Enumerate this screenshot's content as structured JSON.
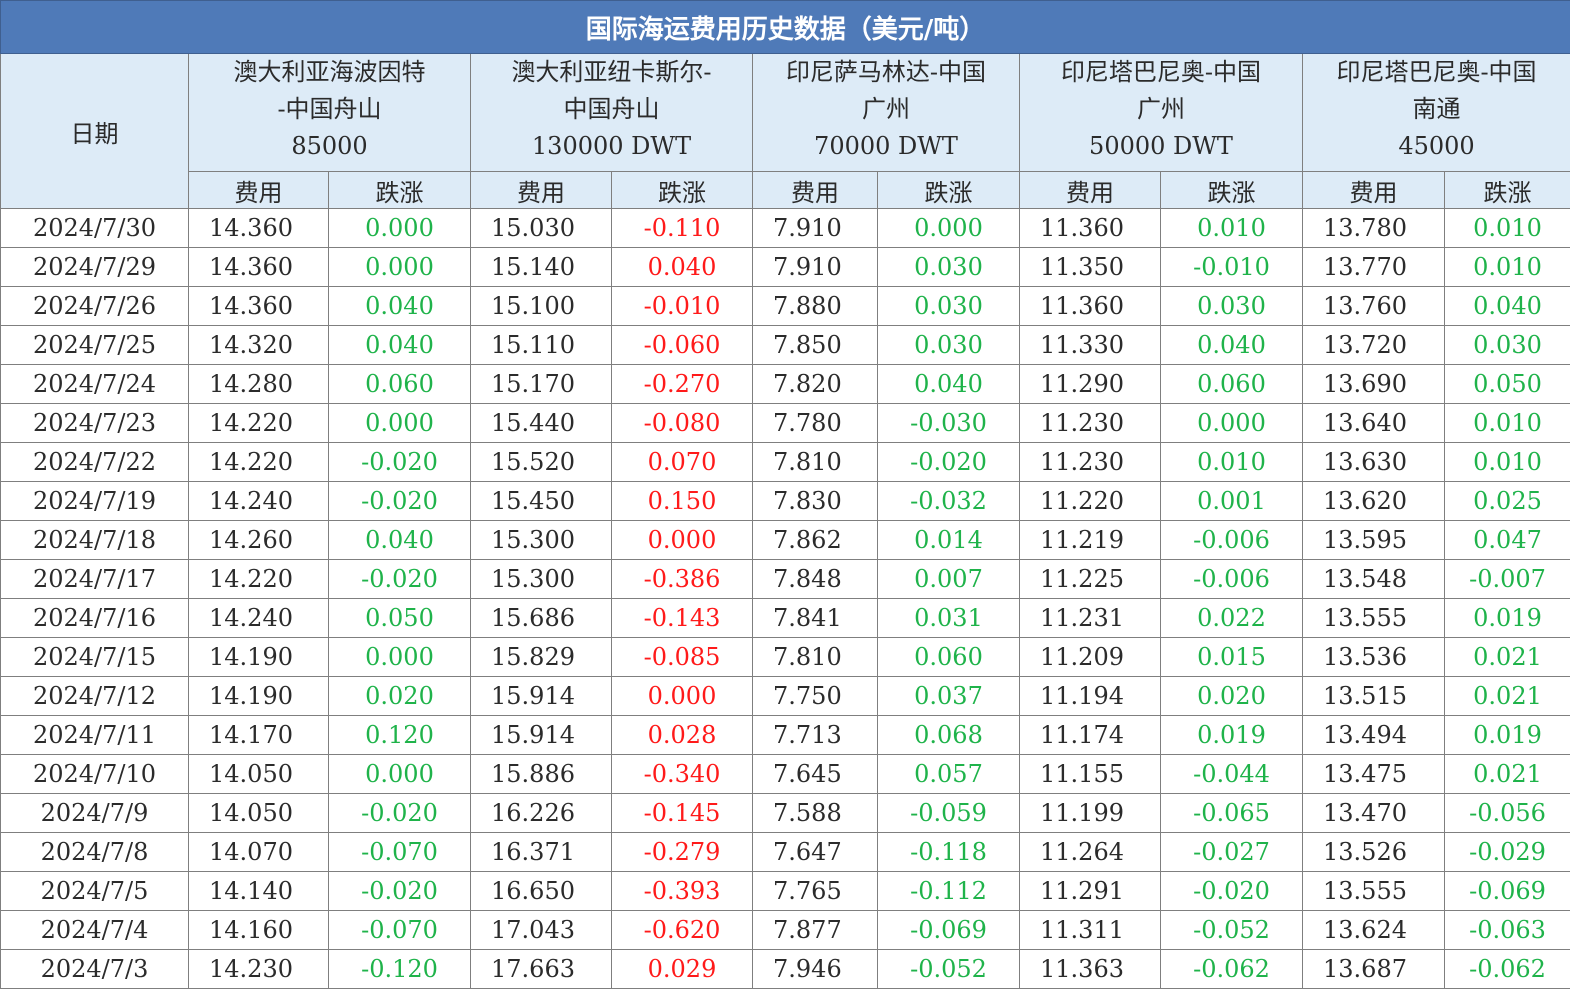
{
  "title": "国际海运费用历史数据（美元/吨）",
  "date_header": "日期",
  "sub_fee": "费用",
  "sub_change": "跌涨",
  "routes": [
    {
      "l1": "澳大利亚海波因特",
      "l2": "-中国舟山",
      "l3": "85000"
    },
    {
      "l1": "澳大利亚纽卡斯尔-",
      "l2": "中国舟山",
      "l3": "130000 DWT"
    },
    {
      "l1": "印尼萨马林达-中国",
      "l2": "广州",
      "l3": "70000 DWT"
    },
    {
      "l1": "印尼塔巴尼奥-中国",
      "l2": "广州",
      "l3": "50000 DWT"
    },
    {
      "l1": "印尼塔巴尼奥-中国",
      "l2": "南通",
      "l3": "45000"
    }
  ],
  "colors": {
    "header_bg": "#4f7ab8",
    "subheader_bg": "#ddebf7",
    "change_positive_col2": "#ff1a1a",
    "change_green": "#1fb34a"
  },
  "rows": [
    [
      "2024/7/30",
      "14.360",
      "0.000",
      "15.030",
      "-0.110",
      "7.910",
      "0.000",
      "11.360",
      "0.010",
      "13.780",
      "0.010"
    ],
    [
      "2024/7/29",
      "14.360",
      "0.000",
      "15.140",
      "0.040",
      "7.910",
      "0.030",
      "11.350",
      "-0.010",
      "13.770",
      "0.010"
    ],
    [
      "2024/7/26",
      "14.360",
      "0.040",
      "15.100",
      "-0.010",
      "7.880",
      "0.030",
      "11.360",
      "0.030",
      "13.760",
      "0.040"
    ],
    [
      "2024/7/25",
      "14.320",
      "0.040",
      "15.110",
      "-0.060",
      "7.850",
      "0.030",
      "11.330",
      "0.040",
      "13.720",
      "0.030"
    ],
    [
      "2024/7/24",
      "14.280",
      "0.060",
      "15.170",
      "-0.270",
      "7.820",
      "0.040",
      "11.290",
      "0.060",
      "13.690",
      "0.050"
    ],
    [
      "2024/7/23",
      "14.220",
      "0.000",
      "15.440",
      "-0.080",
      "7.780",
      "-0.030",
      "11.230",
      "0.000",
      "13.640",
      "0.010"
    ],
    [
      "2024/7/22",
      "14.220",
      "-0.020",
      "15.520",
      "0.070",
      "7.810",
      "-0.020",
      "11.230",
      "0.010",
      "13.630",
      "0.010"
    ],
    [
      "2024/7/19",
      "14.240",
      "-0.020",
      "15.450",
      "0.150",
      "7.830",
      "-0.032",
      "11.220",
      "0.001",
      "13.620",
      "0.025"
    ],
    [
      "2024/7/18",
      "14.260",
      "0.040",
      "15.300",
      "0.000",
      "7.862",
      "0.014",
      "11.219",
      "-0.006",
      "13.595",
      "0.047"
    ],
    [
      "2024/7/17",
      "14.220",
      "-0.020",
      "15.300",
      "-0.386",
      "7.848",
      "0.007",
      "11.225",
      "-0.006",
      "13.548",
      "-0.007"
    ],
    [
      "2024/7/16",
      "14.240",
      "0.050",
      "15.686",
      "-0.143",
      "7.841",
      "0.031",
      "11.231",
      "0.022",
      "13.555",
      "0.019"
    ],
    [
      "2024/7/15",
      "14.190",
      "0.000",
      "15.829",
      "-0.085",
      "7.810",
      "0.060",
      "11.209",
      "0.015",
      "13.536",
      "0.021"
    ],
    [
      "2024/7/12",
      "14.190",
      "0.020",
      "15.914",
      "0.000",
      "7.750",
      "0.037",
      "11.194",
      "0.020",
      "13.515",
      "0.021"
    ],
    [
      "2024/7/11",
      "14.170",
      "0.120",
      "15.914",
      "0.028",
      "7.713",
      "0.068",
      "11.174",
      "0.019",
      "13.494",
      "0.019"
    ],
    [
      "2024/7/10",
      "14.050",
      "0.000",
      "15.886",
      "-0.340",
      "7.645",
      "0.057",
      "11.155",
      "-0.044",
      "13.475",
      "0.021"
    ],
    [
      "2024/7/9",
      "14.050",
      "-0.020",
      "16.226",
      "-0.145",
      "7.588",
      "-0.059",
      "11.199",
      "-0.065",
      "13.470",
      "-0.056"
    ],
    [
      "2024/7/8",
      "14.070",
      "-0.070",
      "16.371",
      "-0.279",
      "7.647",
      "-0.118",
      "11.264",
      "-0.027",
      "13.526",
      "-0.029"
    ],
    [
      "2024/7/5",
      "14.140",
      "-0.020",
      "16.650",
      "-0.393",
      "7.765",
      "-0.112",
      "11.291",
      "-0.020",
      "13.555",
      "-0.069"
    ],
    [
      "2024/7/4",
      "14.160",
      "-0.070",
      "17.043",
      "-0.620",
      "7.877",
      "-0.069",
      "11.311",
      "-0.052",
      "13.624",
      "-0.063"
    ],
    [
      "2024/7/3",
      "14.230",
      "-0.120",
      "17.663",
      "0.029",
      "7.946",
      "-0.052",
      "11.363",
      "-0.062",
      "13.687",
      "-0.062"
    ]
  ]
}
